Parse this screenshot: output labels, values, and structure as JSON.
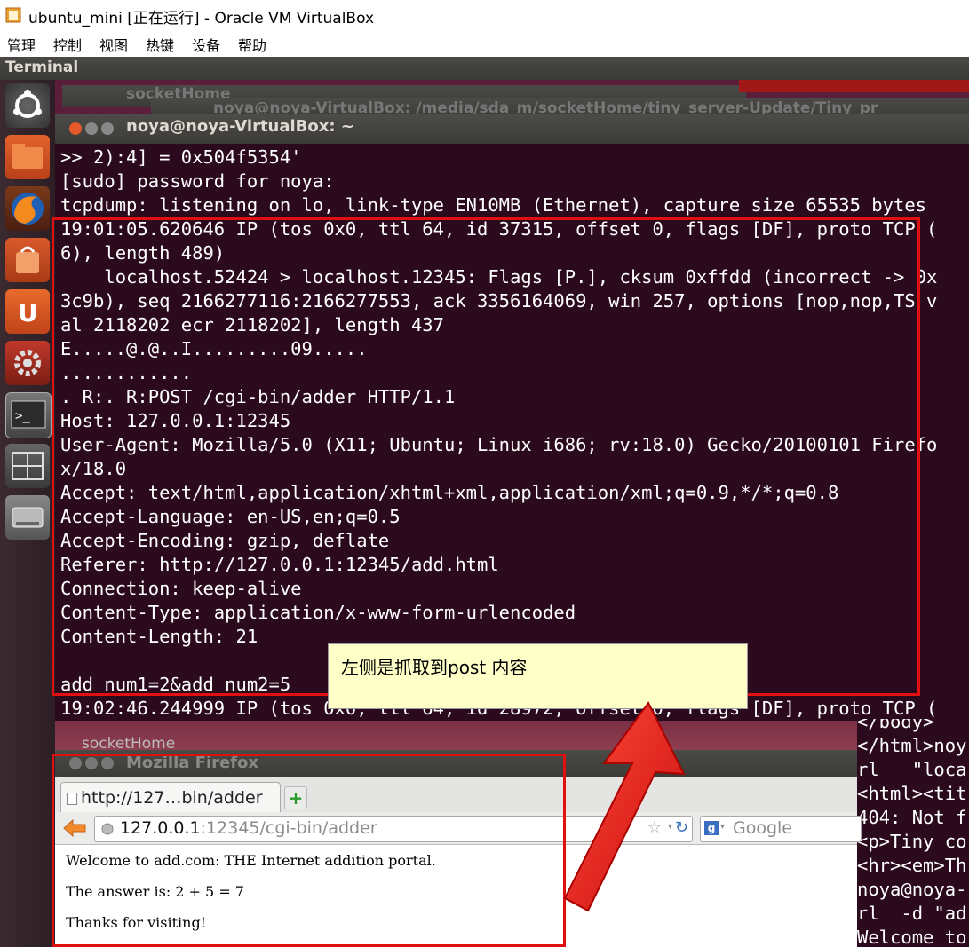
{
  "vbox": {
    "title": "ubuntu_mini [正在运行] - Oracle VM VirtualBox",
    "menu": [
      "管理",
      "控制",
      "视图",
      "热键",
      "设备",
      "帮助"
    ]
  },
  "ubuntu": {
    "panel_title": "Terminal",
    "launcher": [
      "ubuntu-logo-icon",
      "files-icon",
      "firefox-icon",
      "software-center-icon",
      "ubuntu-one-icon",
      "settings-icon",
      "terminal-icon",
      "workspaces-icon",
      "drive-icon"
    ]
  },
  "bg_windows": {
    "socket_home_top": "socketHome",
    "noya_media": "noya@noya-VirtualBox: /media/sda_m/socketHome/tiny_server-Update/Tiny_pr",
    "socket_home_bottom": "socketHome"
  },
  "terminal": {
    "title": "noya@noya-VirtualBox: ~",
    "lines": [
      ">> 2):4] = 0x504f5354'",
      "[sudo] password for noya:",
      "tcpdump: listening on lo, link-type EN10MB (Ethernet), capture size 65535 bytes",
      "19:01:05.620646 IP (tos 0x0, ttl 64, id 37315, offset 0, flags [DF], proto TCP (",
      "6), length 489)",
      "    localhost.52424 > localhost.12345: Flags [P.], cksum 0xffdd (incorrect -> 0x",
      "3c9b), seq 2166277116:2166277553, ack 3356164069, win 257, options [nop,nop,TS v",
      "al 2118202 ecr 2118202], length 437",
      "E.....@.@..I.........09.....",
      "............",
      ". R:. R:POST /cgi-bin/adder HTTP/1.1",
      "Host: 127.0.0.1:12345",
      "User-Agent: Mozilla/5.0 (X11; Ubuntu; Linux i686; rv:18.0) Gecko/20100101 Firefo",
      "x/18.0",
      "Accept: text/html,application/xhtml+xml,application/xml;q=0.9,*/*;q=0.8",
      "Accept-Language: en-US,en;q=0.5",
      "Accept-Encoding: gzip, deflate",
      "Referer: http://127.0.0.1:12345/add.html",
      "Connection: keep-alive",
      "Content-Type: application/x-www-form-urlencoded",
      "Content-Length: 21",
      "",
      "add_num1=2&add_num2=5",
      "19:02:46.244999 IP (tos 0x0, ttl 64, id 28972, offset 0, flags [DF], proto TCP ("
    ]
  },
  "callout": {
    "text": "左侧是抓取到post 内容"
  },
  "right_terminal": {
    "lines": [
      "</body>",
      "</html>noy",
      "rl   \"loca",
      "<html><tit",
      "404: Not f",
      "<p>Tiny co",
      "<hr><em>Th",
      "noya@noya-",
      "rl  -d \"ad",
      "Welcome to"
    ]
  },
  "firefox": {
    "title": "Mozilla Firefox",
    "tab_label": "http://127…bin/adder",
    "url_host": "127.0.0.1",
    "url_rest": ":12345/cgi-bin/adder",
    "search_placeholder": "Google",
    "content": [
      "Welcome to add.com: THE Internet addition portal.",
      "The answer is: 2 + 5 = 7",
      "Thanks for visiting!"
    ]
  },
  "colors": {
    "terminal_bg": "#2c0a1e",
    "highlight_red": "#e01010",
    "callout_bg": "#ffffc8"
  }
}
